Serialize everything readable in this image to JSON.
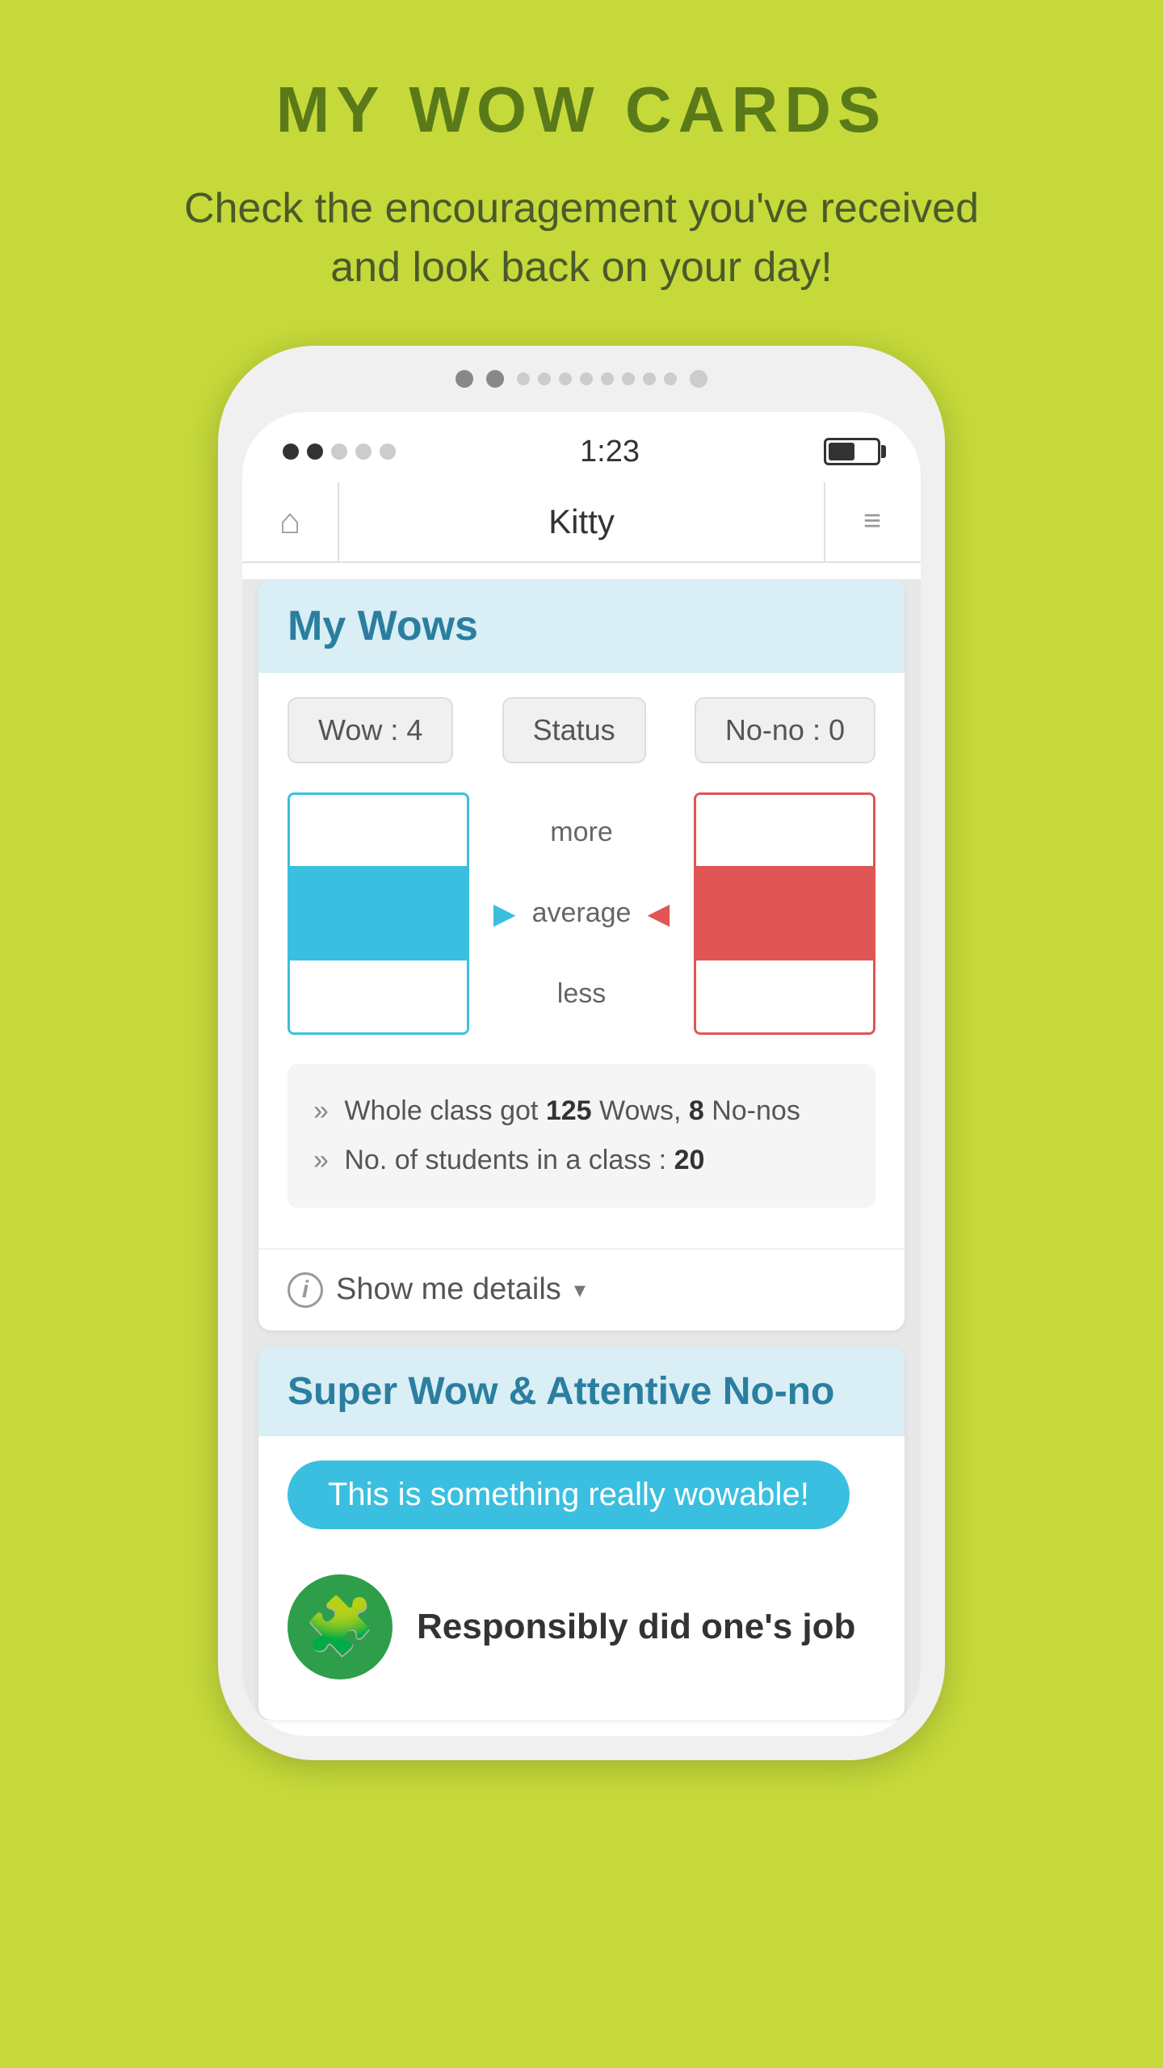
{
  "page": {
    "background_color": "#c5d93a",
    "title": "MY WOW CARDS",
    "subtitle": "Check the encouragement you've received\nand look back on your day!"
  },
  "status_bar": {
    "time": "1:23",
    "signal_dots": [
      "filled",
      "filled",
      "empty",
      "empty",
      "empty"
    ],
    "battery_level": 55
  },
  "nav": {
    "home_icon": "⌂",
    "title": "Kitty",
    "menu_icon": "≡"
  },
  "pagination": {
    "dots": [
      "filled",
      "filled",
      "small",
      "small",
      "small",
      "small",
      "small",
      "small",
      "small",
      "small",
      "filled"
    ]
  },
  "my_wows": {
    "card_title": "My Wows",
    "wow_badge": "Wow : 4",
    "status_badge": "Status",
    "nono_badge": "No-no : 0",
    "chart_labels": {
      "more": "more",
      "average": "average",
      "less": "less"
    },
    "stats_line1_prefix": "Whole class got ",
    "stats_wow_count": "125",
    "stats_wow_label": " Wows, ",
    "stats_nono_count": "8",
    "stats_nono_label": " No-nos",
    "stats_line2_prefix": "No. of students in a class : ",
    "stats_student_count": "20",
    "show_details_label": "Show me details",
    "info_symbol": "i"
  },
  "super_wow": {
    "card_title": "Super Wow & Attentive No-no",
    "wow_label": "This is something really wowable!",
    "resp_text": "Responsibly did one's job",
    "puzzle_icon": "🧩"
  }
}
